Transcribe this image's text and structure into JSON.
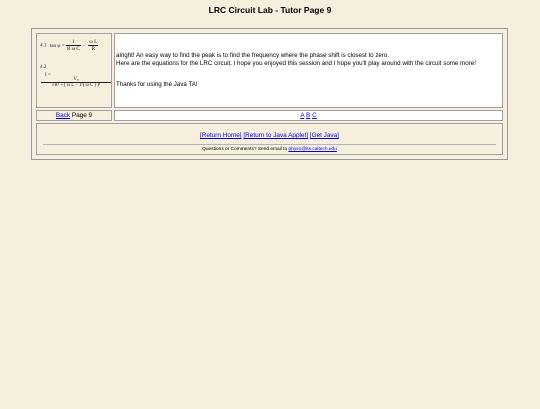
{
  "page": {
    "title": "LRC Circuit Lab - Tutor Page 9"
  },
  "equations": {
    "eq1_number": "4.1",
    "eq1_lhs": "tan φ =",
    "eq1_frac1_num": "1",
    "eq1_frac1_den": "R ω C",
    "eq1_minus": "−",
    "eq1_frac2_num": "ω L",
    "eq1_frac2_den": "R",
    "eq2_number": "4.2",
    "eq2_lhs": "I =",
    "eq2_num": "V₀",
    "eq2_den": "√R² + ( ω L − 1/( ω C ) )²"
  },
  "content": {
    "paragraph1": "alright! An easy way to find the peak is to find the frequency where the phase shift is closest to zero.",
    "paragraph2": "Here are the equations for the LRC circuit, I hope you enjoyed this session and I hope you'll play around with the circuit some more!",
    "paragraph3": "Thanks for using the Java TA!"
  },
  "nav": {
    "back_label": "Back",
    "page_label": "Page 9",
    "link_a": "A",
    "link_b": "B",
    "link_c": "C"
  },
  "footer": {
    "return_home": "[Return Home]",
    "return_applet": "[Return to Java Applet]",
    "get_java": "[Get Java]",
    "contact_prefix": "Questions or Comments? Send email to",
    "contact_email": "phys1@its.caltech.edu"
  }
}
